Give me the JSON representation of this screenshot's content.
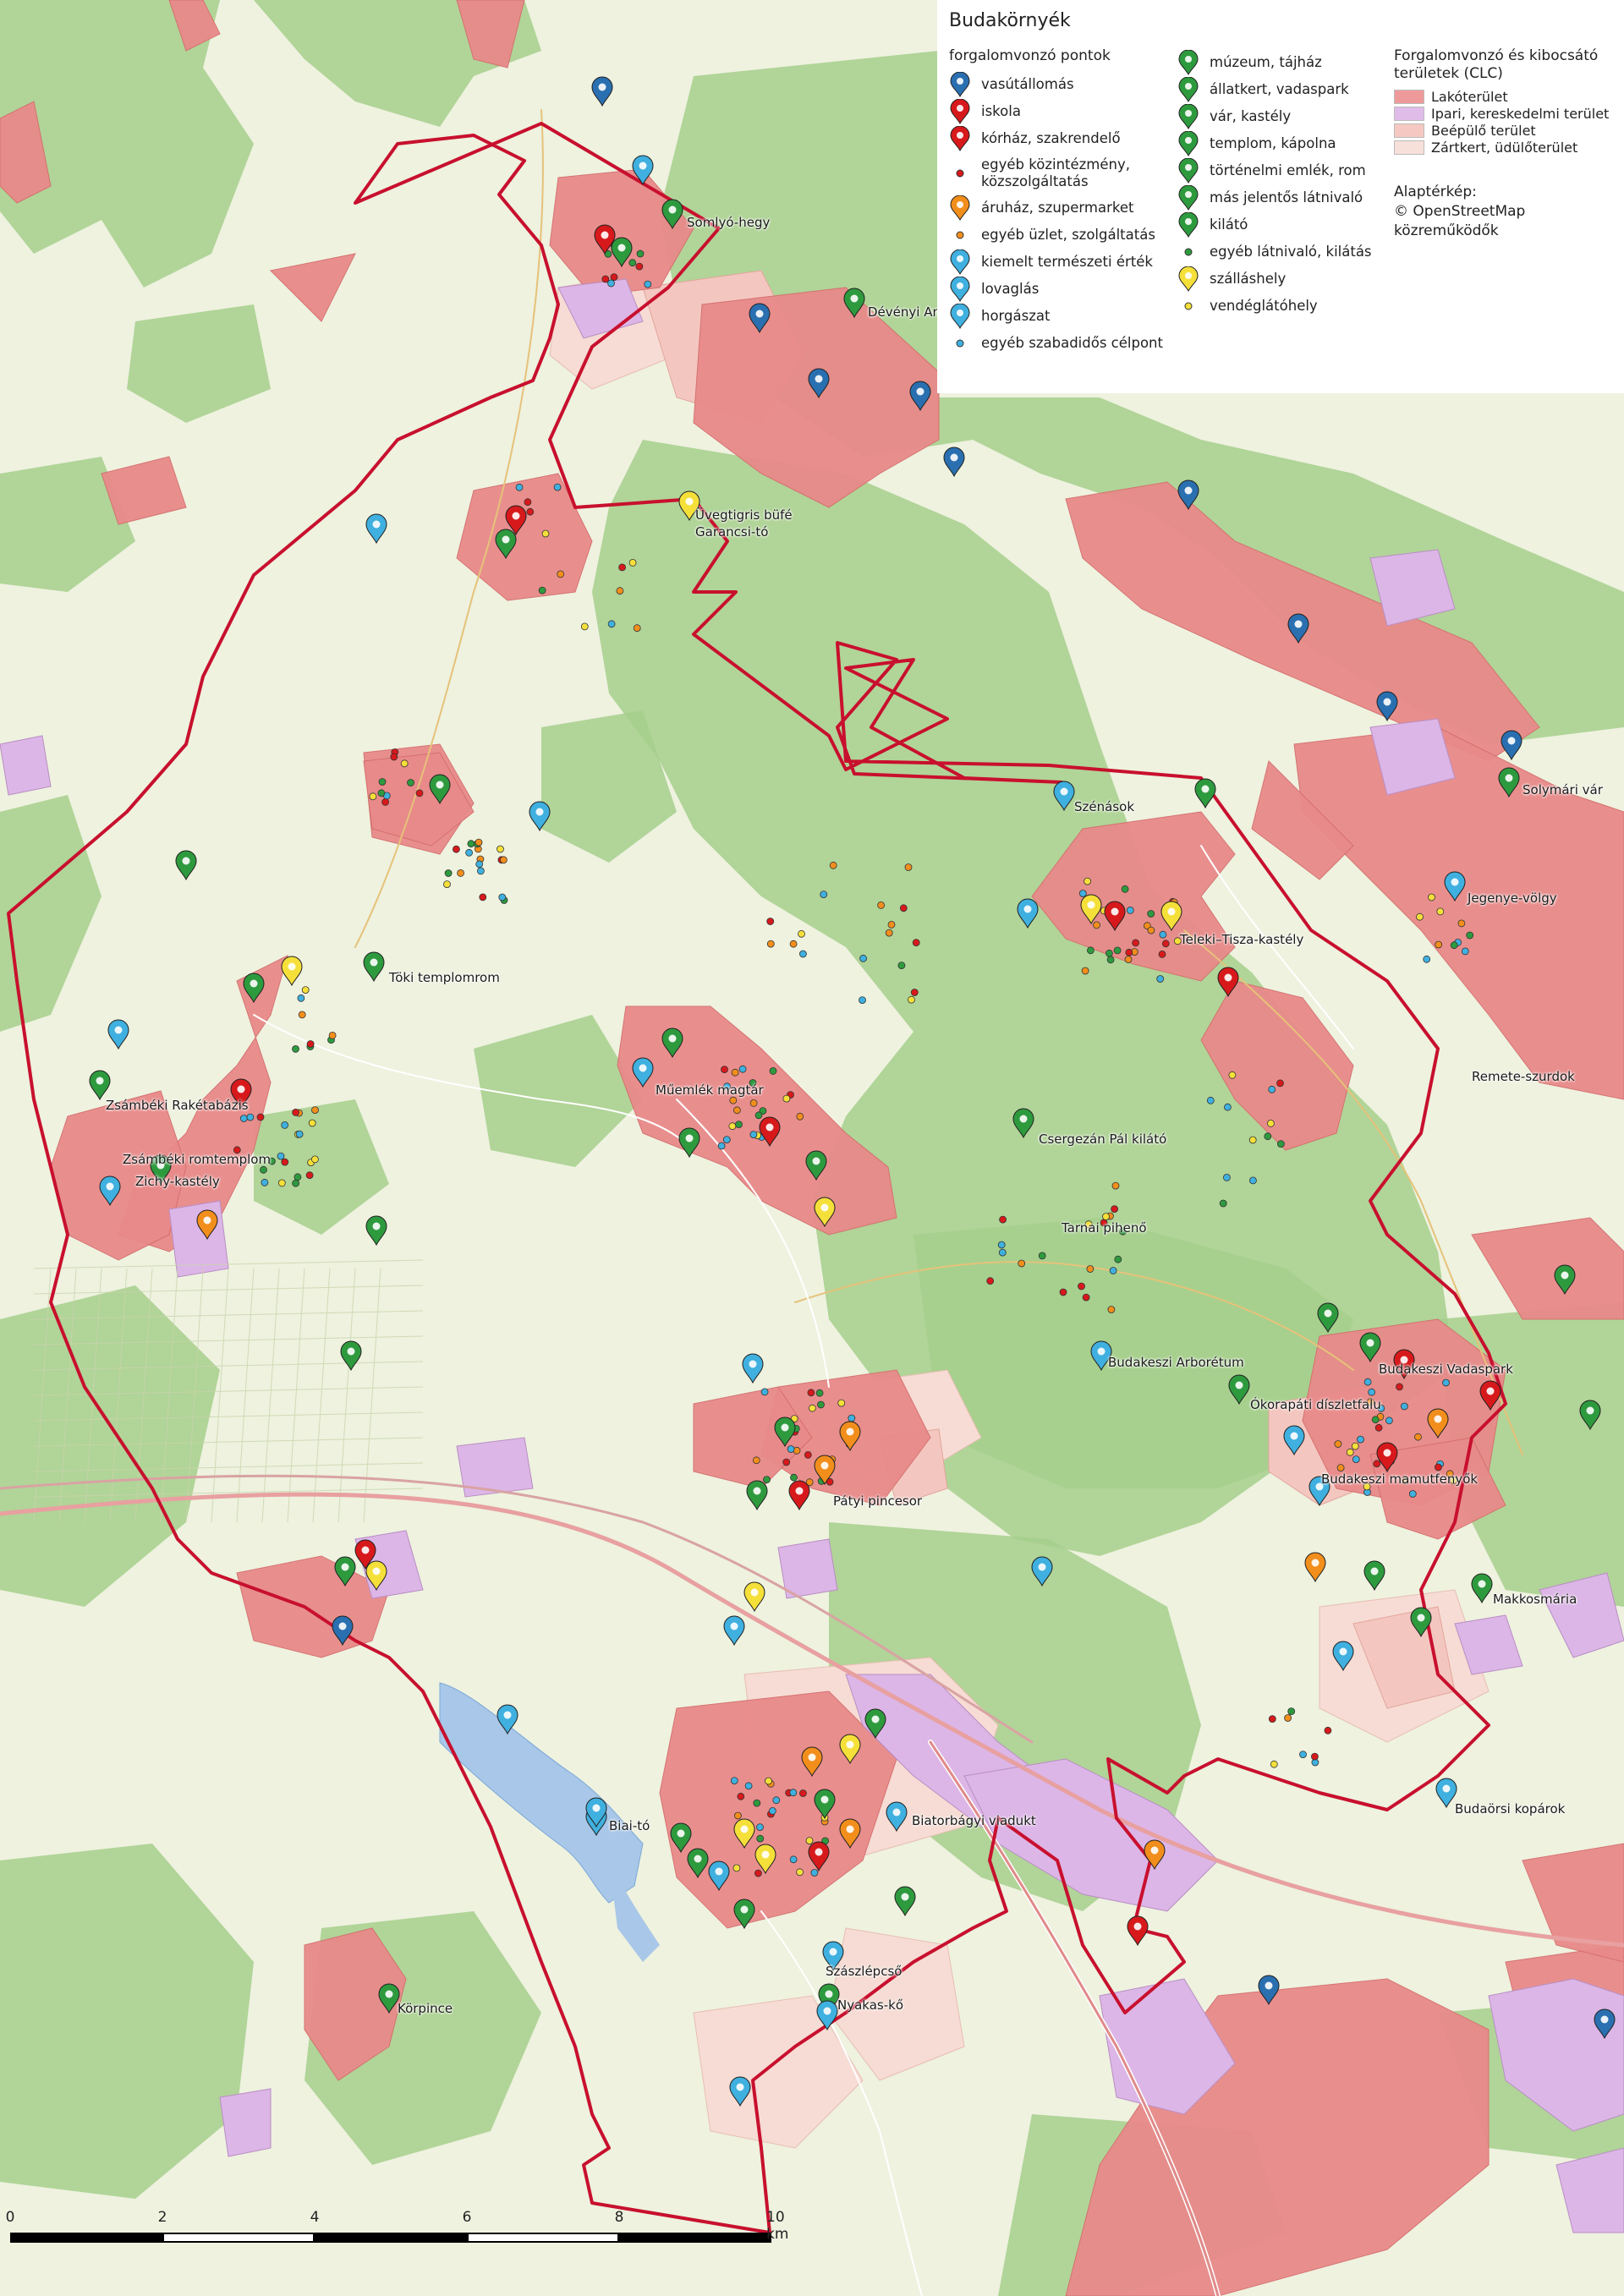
{
  "map": {
    "title": "Budakörnyék",
    "colors": {
      "background": "#eef2df",
      "forest": "#a6cf8c",
      "residential": "#e88a8a",
      "industrial": "#dcb6e6",
      "built_up": "#f3c7c0",
      "gardens": "#f6dcd4",
      "boundary": "#c8102e",
      "road_main": "#e8a0a0",
      "water": "#a9c7e8"
    },
    "place_labels": [
      "Somlyó-hegy",
      "Dévényi Antal",
      "Üvegtigris büfé",
      "Garancsi-tó",
      "Szénások",
      "Solymári vár",
      "Jegenye-völgy",
      "Teleki–Tisza-kastély",
      "Töki templomrom",
      "Zsámbéki Rakétabázis",
      "Zsámbéki romtemplom",
      "Zichy-kastély",
      "Műemlék magtár",
      "Remete-szurdok",
      "Csergezán Pál kilátó",
      "Tarnai pihenő",
      "Budakeszi Arborétum",
      "Budakeszi Vadaspark",
      "Ókorapáti díszletfalu",
      "Budakeszi mamutfenyők",
      "Pátyi pincesor",
      "Makkosmária",
      "Budaörsi kopárok",
      "Biatorbágyi viadukt",
      "Biai-tó",
      "Szászlépcső",
      "Nyakas-kő",
      "Körpince"
    ]
  },
  "legend": {
    "title": "Budakörnyék",
    "points_heading": "forgalomvonzó pontok",
    "col1": [
      {
        "label": "vasútállomás",
        "symbol": "pin",
        "color": "#2a6fb0",
        "icon": "train-icon"
      },
      {
        "label": "iskola",
        "symbol": "pin",
        "color": "#d7191c",
        "icon": "school-icon"
      },
      {
        "label": "kórház, szakrendelő",
        "symbol": "pin",
        "color": "#d7191c",
        "icon": "hospital-icon"
      },
      {
        "label": "egyéb közintézmény, közszolgáltatás",
        "symbol": "dot",
        "color": "#d7191c",
        "icon": "public-service-dot-icon"
      },
      {
        "label": "áruház, szupermarket",
        "symbol": "pin",
        "color": "#f28e1c",
        "icon": "shopping-cart-icon"
      },
      {
        "label": "egyéb üzlet, szolgáltatás",
        "symbol": "dot",
        "color": "#f28e1c",
        "icon": "shop-dot-icon"
      },
      {
        "label": "kiemelt természeti érték",
        "symbol": "pin",
        "color": "#3fb0df",
        "icon": "tree-icon"
      },
      {
        "label": "lovaglás",
        "symbol": "pin",
        "color": "#3fb0df",
        "icon": "horse-riding-icon"
      },
      {
        "label": "horgászat",
        "symbol": "pin",
        "color": "#3fb0df",
        "icon": "fishing-icon"
      },
      {
        "label": "egyéb szabadidős célpont",
        "symbol": "dot",
        "color": "#3fb0df",
        "icon": "leisure-dot-icon"
      }
    ],
    "col2": [
      {
        "label": "múzeum, tájház",
        "symbol": "pin",
        "color": "#2e9a3e",
        "icon": "museum-icon"
      },
      {
        "label": "állatkert, vadaspark",
        "symbol": "pin",
        "color": "#2e9a3e",
        "icon": "zoo-icon"
      },
      {
        "label": "vár, kastély",
        "symbol": "pin",
        "color": "#2e9a3e",
        "icon": "castle-icon"
      },
      {
        "label": "templom, kápolna",
        "symbol": "pin",
        "color": "#2e9a3e",
        "icon": "church-icon"
      },
      {
        "label": "történelmi emlék, rom",
        "symbol": "pin",
        "color": "#2e9a3e",
        "icon": "monument-icon"
      },
      {
        "label": "más jelentős látnivaló",
        "symbol": "pin",
        "color": "#2e9a3e",
        "icon": "sight-icon"
      },
      {
        "label": "kilátó",
        "symbol": "pin",
        "color": "#2e9a3e",
        "icon": "viewpoint-icon"
      },
      {
        "label": "egyéb látnivaló, kilátás",
        "symbol": "dot",
        "color": "#2e9a3e",
        "icon": "sight-dot-icon"
      },
      {
        "label": "szálláshely",
        "symbol": "pin",
        "color": "#f5e03a",
        "icon": "bed-icon"
      },
      {
        "label": "vendéglátóhely",
        "symbol": "dot",
        "color": "#f5e03a",
        "icon": "restaurant-dot-icon"
      }
    ],
    "clc_heading": "Forgalomvonzó és kibocsátó területek (CLC)",
    "clc": [
      {
        "label": "Lakóterület",
        "color": "#ef9a9a"
      },
      {
        "label": "Ipari, kereskedelmi terület",
        "color": "#e0bce9"
      },
      {
        "label": "Beépülő terület",
        "color": "#f5c9c2"
      },
      {
        "label": "Zártkert, üdülőterület",
        "color": "#f8e0da"
      }
    ],
    "basemap_heading": "Alaptérkép:",
    "basemap_credit_1": "© OpenStreetMap",
    "basemap_credit_2": "közreműködők"
  },
  "scale": {
    "ticks": [
      "0",
      "2",
      "4",
      "6",
      "8",
      "10 km"
    ]
  }
}
